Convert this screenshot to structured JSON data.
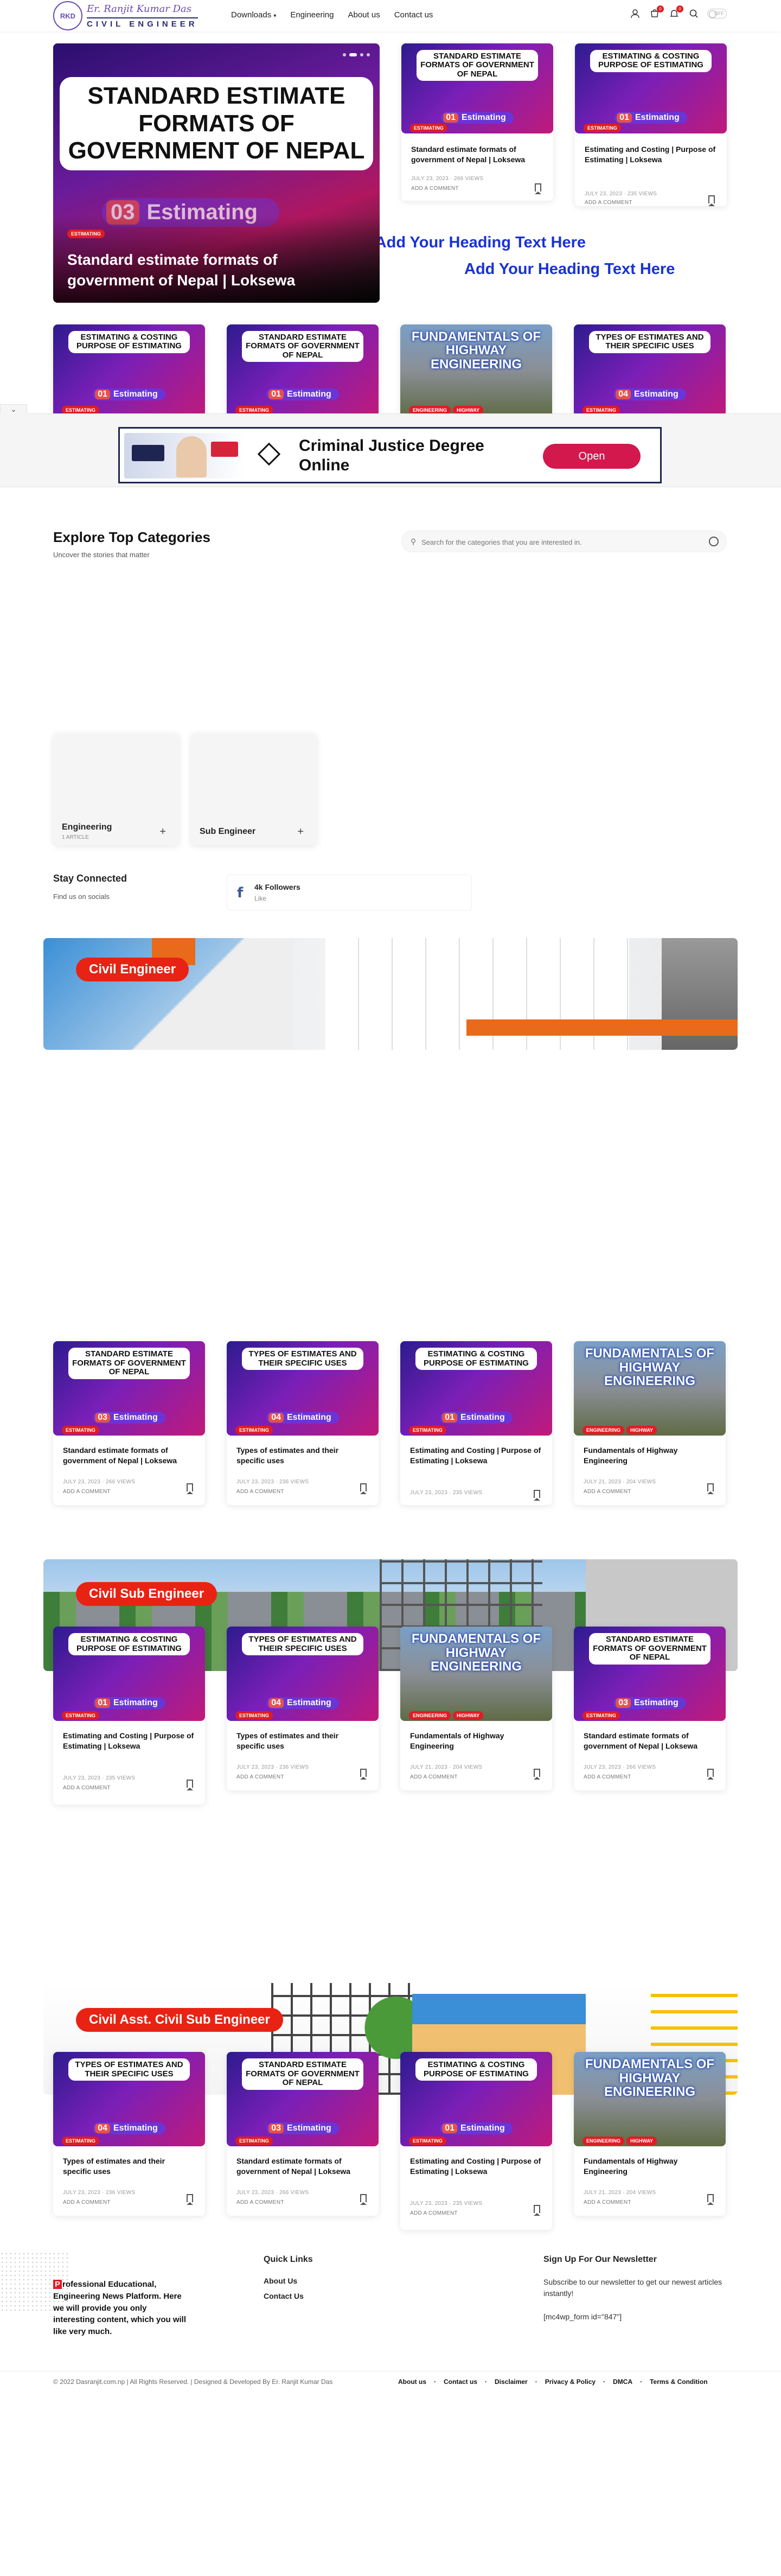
{
  "header": {
    "logo_name": "Er. Ranjit Kumar Das",
    "logo_title": "CIVIL ENGINEER",
    "logo_mark": "RKD",
    "nav": [
      "Downloads",
      "Engineering",
      "About us",
      "Contact us"
    ],
    "cart_count": "0",
    "bell_count": "0",
    "toggle": "OFF"
  },
  "hero": {
    "thumb_line": "STANDARD ESTIMATE FORMATS OF GOVERNMENT OF NEPAL",
    "pill_num": "03",
    "pill_text": "Estimating",
    "tag": "ESTIMATING",
    "title": "Standard estimate formats of government of Nepal | Loksewa"
  },
  "thumb_texts": {
    "standard": "STANDARD ESTIMATE FORMATS OF GOVERNMENT OF NEPAL",
    "costing": "ESTIMATING & COSTING PURPOSE OF ESTIMATING",
    "types": "TYPES OF ESTIMATES AND THEIR SPECIFIC USES",
    "fundamentals": "FUNDAMENTALS OF HIGHWAY ENGINEERING",
    "estimating": "Estimating",
    "n01": "01",
    "n03": "03",
    "n04": "04"
  },
  "tags": {
    "estimating": "ESTIMATING",
    "engineering": "ENGINEERING",
    "highway": "HIGHWAY"
  },
  "posts": {
    "standard": {
      "title": "Standard estimate formats of government of Nepal | Loksewa",
      "date": "JULY 23, 2023",
      "views": "266 VIEWS"
    },
    "costing": {
      "title": "Estimating and Costing | Purpose of Estimating | Loksewa",
      "date": "JULY 23, 2023",
      "views": "235 VIEWS"
    },
    "types": {
      "title": "Types of estimates and their specific uses",
      "date": "JULY 23, 2023",
      "views": "236 VIEWS"
    },
    "fundamentals": {
      "title": "Fundamentals of Highway Engineering",
      "date": "JULY 21, 2023",
      "views": "204 VIEWS"
    },
    "add_comment": "ADD A COMMENT"
  },
  "blue_headings": [
    "Add Your Heading Text Here",
    "Add Your Heading Text Here"
  ],
  "ad": {
    "text": "Criminal Justice Degree Online",
    "button": "Open"
  },
  "categories": {
    "title": "Explore Top Categories",
    "subtitle": "Uncover the stories that matter",
    "search_placeholder": "Search for the categories that you are interested in.",
    "items": [
      {
        "name": "Engineering",
        "count": "1 ARTICLE"
      },
      {
        "name": "Sub Engineer",
        "count": ""
      }
    ]
  },
  "social": {
    "title": "Stay Connected",
    "subtitle": "Find us on socials",
    "followers": "4k Followers",
    "action": "Like"
  },
  "banners": [
    "Civil Engineer",
    "Civil Sub Engineer",
    "Civil Asst. Civil Sub Engineer"
  ],
  "footer": {
    "about": "Professional Educational, Engineering News Platform. Here we will provide you only interesting content, which you will like very much.",
    "about_first": "P",
    "quick_links_title": "Quick Links",
    "quick_links": [
      "About Us",
      "Contact Us"
    ],
    "newsletter_title": "Sign Up For Our Newsletter",
    "newsletter_text": "Subscribe to our newsletter to get our newest articles instantly!",
    "newsletter_form": "[mc4wp_form id=\"847\"]",
    "copyright": "© 2022 Dasranjit.com.np | All Rights Reserved. | Designed & Developed By Er. Ranjit Kumar Das",
    "links": [
      "About us",
      "Contact us",
      "Disclaimer",
      "Privacy & Policy",
      "DMCA",
      "Terms & Condition"
    ]
  }
}
